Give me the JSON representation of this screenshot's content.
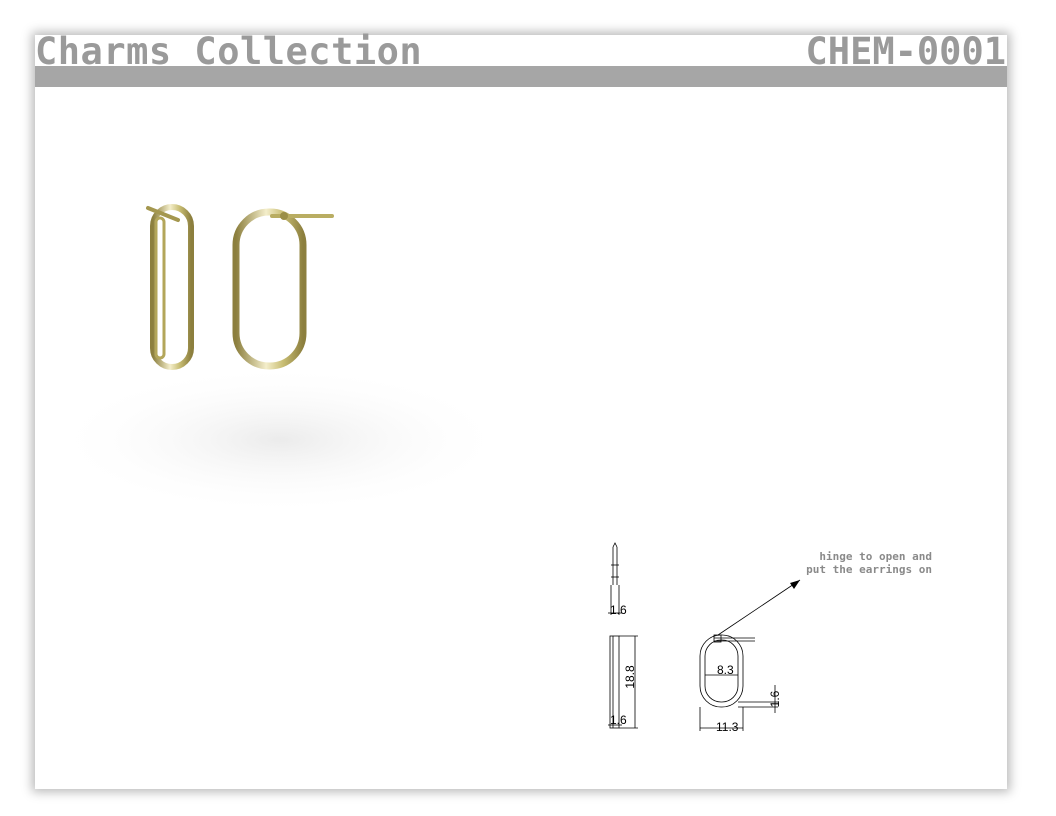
{
  "header": {
    "title": "Charms Collection",
    "code": "CHEM-0001"
  },
  "product_render": {
    "description_icon": "gold-oval-hoop-earrings-icon",
    "metal_color": "#c9be74",
    "highlight_color": "#f4eecb",
    "shadow_color": "#8c7f3e"
  },
  "technical_drawing": {
    "dimensions": {
      "top_view_thickness": "1.6",
      "side_view_height": "18.8",
      "side_view_thickness": "1.6",
      "front_inner_width": "8.3",
      "front_wire_thickness": "1.6",
      "front_outer_width": "11.3"
    },
    "note_lines": [
      "hinge to open and",
      "put the earrings on"
    ]
  }
}
